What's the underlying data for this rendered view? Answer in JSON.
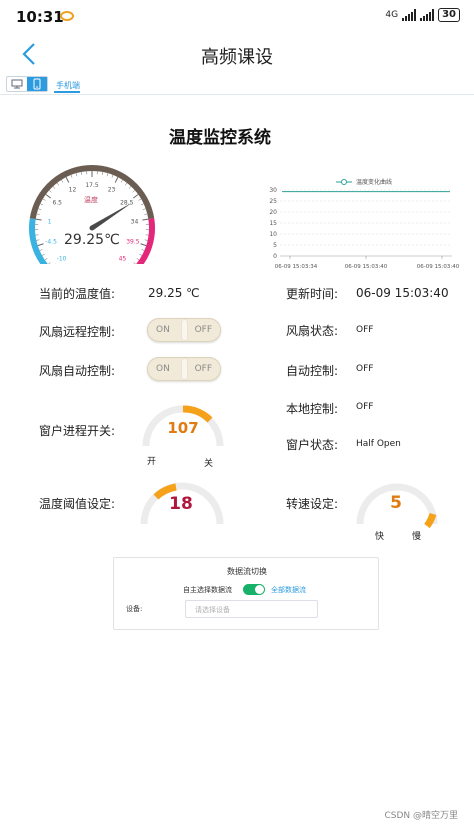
{
  "status": {
    "time": "10:31",
    "network": "4G",
    "battery": "30"
  },
  "nav": {
    "title": "高频课设",
    "back_icon": "chevron-left-icon"
  },
  "toolbar": {
    "tab_mobile": "手机端"
  },
  "system_title": "温度监控系统",
  "gauge": {
    "label": "温度",
    "reading": "29.25℃",
    "value": 29.25,
    "min": -10,
    "max": 45,
    "ticks": [
      "-10",
      "-4.5",
      "1",
      "6.5",
      "12",
      "17.5",
      "23",
      "28.5",
      "34",
      "39.5",
      "45"
    ]
  },
  "chart_data": {
    "type": "line",
    "legend": "温度变化曲线",
    "x": [
      "06-09 15:03:34",
      "06-09 15:03:40",
      "06-09 15:03:40"
    ],
    "series": [
      {
        "name": "温度变化曲线",
        "values": [
          29.25,
          29.25,
          29.25
        ]
      }
    ],
    "yticks": [
      "30",
      "25",
      "20",
      "15",
      "10",
      "5",
      "0"
    ],
    "ylim": [
      0,
      30
    ],
    "grid": true,
    "color": "#2aa198"
  },
  "left_rows": {
    "current_temp_label": "当前的温度值:",
    "current_temp_value": "29.25  ℃",
    "fan_remote_label": "风扇远程控制:",
    "fan_auto_label": "风扇自动控制:",
    "window_label": "窗户进程开关:",
    "temp_threshold_label": "温度阈值设定:"
  },
  "toggles": {
    "on": "ON",
    "off": "OFF"
  },
  "right_rows": {
    "update_time_label": "更新时间:",
    "update_time_value": "06-09 15:03:40",
    "fan_state_label": "风扇状态:",
    "fan_state_value": "OFF",
    "auto_ctrl_label": "自动控制:",
    "auto_ctrl_value": "OFF",
    "local_ctrl_label": "本地控制:",
    "local_ctrl_value": "OFF",
    "window_state_label": "窗户状态:",
    "window_state_value": "Half Open",
    "speed_label": "转速设定:"
  },
  "dials": {
    "window": {
      "value": "107",
      "left_label": "开",
      "right_label": "关",
      "color": "#e07b12"
    },
    "threshold": {
      "value": "18",
      "color": "#b0173c"
    },
    "speed": {
      "value": "5",
      "left_label": "快",
      "right_label": "慢",
      "color": "#e07b12"
    }
  },
  "panel": {
    "title": "数据流切换",
    "switch_label": "自主选择数据流",
    "all_label": "全部数据流",
    "device_label": "设备:",
    "device_placeholder": "请选择设备"
  },
  "watermark": "CSDN @晴空万里"
}
